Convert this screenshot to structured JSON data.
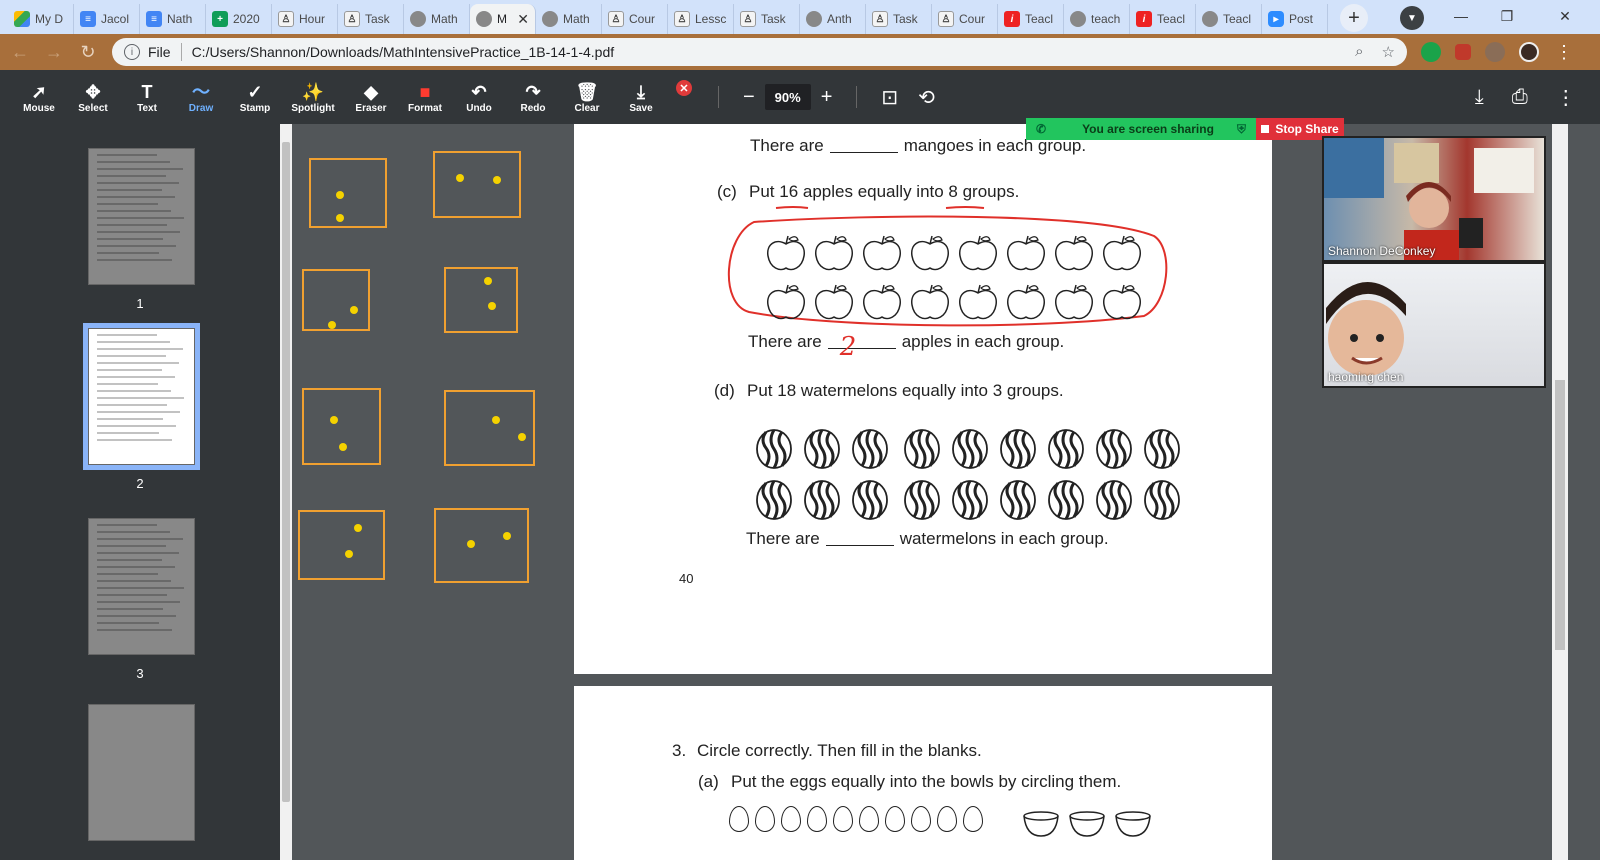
{
  "browser": {
    "tabs": [
      {
        "label": "My D",
        "icon": "drive-icon",
        "active": false
      },
      {
        "label": "Jacol",
        "icon": "docs-icon",
        "active": false
      },
      {
        "label": "Nath",
        "icon": "docs-icon",
        "active": false
      },
      {
        "label": "2020",
        "icon": "sheets-icon",
        "active": false
      },
      {
        "label": "Hour",
        "icon": "tpt-icon",
        "active": false
      },
      {
        "label": "Task",
        "icon": "tpt-icon",
        "active": false
      },
      {
        "label": "Math",
        "icon": "globe-icon",
        "active": false
      },
      {
        "label": "M",
        "icon": "globe-icon",
        "active": true
      },
      {
        "label": "Math",
        "icon": "globe-icon",
        "active": false
      },
      {
        "label": "Cour",
        "icon": "tpt-icon",
        "active": false
      },
      {
        "label": "Lessc",
        "icon": "tpt-icon",
        "active": false
      },
      {
        "label": "Task",
        "icon": "tpt-icon",
        "active": false
      },
      {
        "label": "Anth",
        "icon": "globe-icon",
        "active": false
      },
      {
        "label": "Task",
        "icon": "tpt-icon",
        "active": false
      },
      {
        "label": "Cour",
        "icon": "tpt-icon",
        "active": false
      },
      {
        "label": "Teacl",
        "icon": "teach-icon",
        "active": false
      },
      {
        "label": "teach",
        "icon": "globe-icon",
        "active": false
      },
      {
        "label": "Teacl",
        "icon": "teach-icon",
        "active": false
      },
      {
        "label": "Teacl",
        "icon": "globe-icon",
        "active": false
      },
      {
        "label": "Post",
        "icon": "zoom-icon",
        "active": false
      }
    ],
    "address": {
      "scheme_label": "File",
      "url": "C:/Users/Shannon/Downloads/MathIntensivePractice_1B-14-1-4.pdf"
    }
  },
  "toolbar": {
    "tools": [
      {
        "label": "Mouse",
        "glyph": "➚",
        "icon": "mouse-pointer-icon"
      },
      {
        "label": "Select",
        "glyph": "✥",
        "icon": "move-icon"
      },
      {
        "label": "Text",
        "glyph": "T",
        "icon": "text-icon"
      },
      {
        "label": "Draw",
        "glyph": "〜",
        "icon": "draw-icon",
        "active": true
      },
      {
        "label": "Stamp",
        "glyph": "✓",
        "icon": "stamp-icon"
      },
      {
        "label": "Spotlight",
        "glyph": "✨",
        "icon": "spotlight-icon"
      },
      {
        "label": "Eraser",
        "glyph": "◆",
        "icon": "eraser-icon"
      },
      {
        "label": "Format",
        "glyph": "■",
        "icon": "format-icon"
      },
      {
        "label": "Undo",
        "glyph": "↶",
        "icon": "undo-icon"
      },
      {
        "label": "Redo",
        "glyph": "↷",
        "icon": "redo-icon"
      },
      {
        "label": "Clear",
        "glyph": "🗑",
        "icon": "trash-icon"
      },
      {
        "label": "Save",
        "glyph": "⤓",
        "icon": "save-icon"
      }
    ],
    "zoom_value": "90%",
    "accent": "#6fb1ff",
    "format_color": "#ff3b30"
  },
  "thumbnails": [
    {
      "page": "1",
      "selected": false
    },
    {
      "page": "2",
      "selected": true
    },
    {
      "page": "3",
      "selected": false
    }
  ],
  "whiteboard": {
    "box_color": "#f0a030",
    "dot_color": "#f5d200"
  },
  "pdf": {
    "q_b_tail": {
      "prefix": "There are",
      "suffix": "mangoes in each group."
    },
    "q_c": {
      "label": "(c)",
      "text": "Put 16 apples equally into 8 groups.",
      "answer_prefix": "There are",
      "answer_suffix": "apples in each group.",
      "handwritten_answer": "2",
      "apple_count": 16
    },
    "q_d": {
      "label": "(d)",
      "text": "Put 18 watermelons equally into 3 groups.",
      "answer_prefix": "There are",
      "answer_suffix": "watermelons in each group.",
      "melon_count": 18
    },
    "page_number": "40",
    "q3": {
      "label": "3.",
      "text": "Circle correctly. Then fill in the blanks.",
      "a_label": "(a)",
      "a_text": "Put the eggs equally into the bowls by circling them.",
      "egg_count": 10,
      "bowl_count": 3
    },
    "annotation_color": "#e0302a"
  },
  "zoom": {
    "sharing_text": "You are screen sharing",
    "stop_label": "Stop Share",
    "participants": [
      {
        "name": "Shannon DeConkey"
      },
      {
        "name": "haoming chen"
      }
    ],
    "sharing_color": "#22c55e",
    "stop_color": "#e0303a"
  }
}
